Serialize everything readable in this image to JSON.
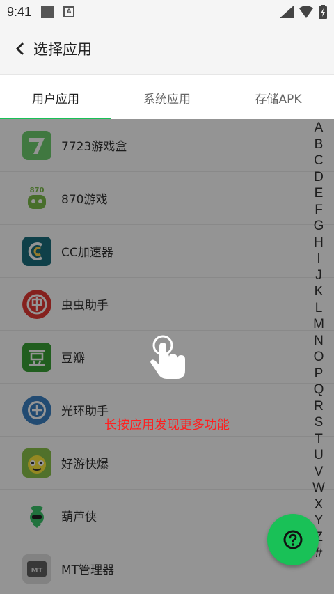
{
  "status_bar": {
    "time": "9:41"
  },
  "app_bar": {
    "title": "选择应用"
  },
  "tabs": [
    {
      "label": "用户应用",
      "active": true
    },
    {
      "label": "系统应用",
      "active": false
    },
    {
      "label": "存储APK",
      "active": false
    }
  ],
  "apps": [
    {
      "name": "7723游戏盒",
      "icon": "7723-app-icon",
      "color": "#6fcf6f"
    },
    {
      "name": "870游戏",
      "icon": "870-app-icon",
      "color": "#7dbd4a"
    },
    {
      "name": "CC加速器",
      "icon": "cc-accelerator-icon",
      "color": "#1a7a8a"
    },
    {
      "name": "虫虫助手",
      "icon": "chongchong-icon",
      "color": "#e53935"
    },
    {
      "name": "豆瓣",
      "icon": "douban-icon",
      "color": "#3aa336"
    },
    {
      "name": "光环助手",
      "icon": "guanghuan-icon",
      "color": "#3b82c4"
    },
    {
      "name": "好游快爆",
      "icon": "haoyou-icon",
      "color": "#8bc34a"
    },
    {
      "name": "葫芦侠",
      "icon": "huluxia-icon",
      "color": "#3ac46a"
    },
    {
      "name": "MT管理器",
      "icon": "mt-manager-icon",
      "color": "#616161"
    }
  ],
  "alphabet": [
    "A",
    "B",
    "C",
    "D",
    "E",
    "F",
    "G",
    "H",
    "I",
    "J",
    "K",
    "L",
    "M",
    "N",
    "O",
    "P",
    "Q",
    "R",
    "S",
    "T",
    "U",
    "V",
    "W",
    "X",
    "Y",
    "Z",
    "#"
  ],
  "hint": "长按应用发现更多功能",
  "fab": {
    "label": "?"
  }
}
